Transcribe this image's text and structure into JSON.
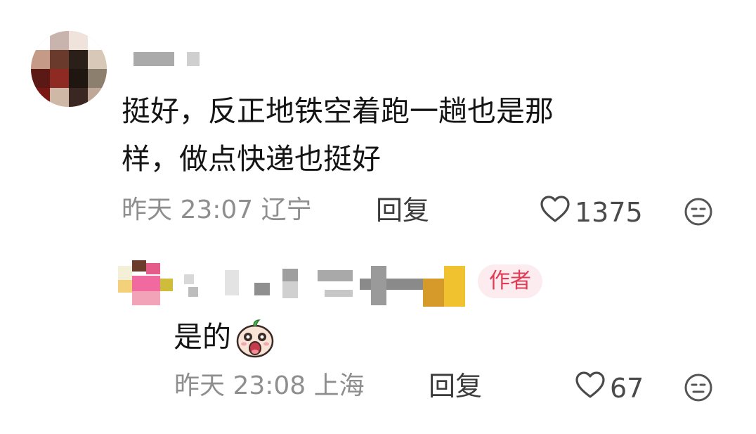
{
  "comments": [
    {
      "text_line1": "挺好，反正地铁空着跑一趟也是那",
      "text_line2": "样，做点快递也挺好",
      "meta": "昨天 23:07 辽宁",
      "reply_label": "回复",
      "likes": "1375"
    },
    {
      "author_badge": "作者",
      "text": "是的",
      "meta": "昨天 23:08 上海",
      "reply_label": "回复",
      "likes": "67"
    }
  ],
  "icons": {
    "like": "heart-outline-icon",
    "emoji_react": "neutral-face-icon",
    "inline_emoji": "surprised-face-emoji"
  },
  "colors": {
    "text": "#141414",
    "meta": "#8e8e8e",
    "badge_bg": "#fdecef",
    "badge_text": "#e23b55"
  }
}
